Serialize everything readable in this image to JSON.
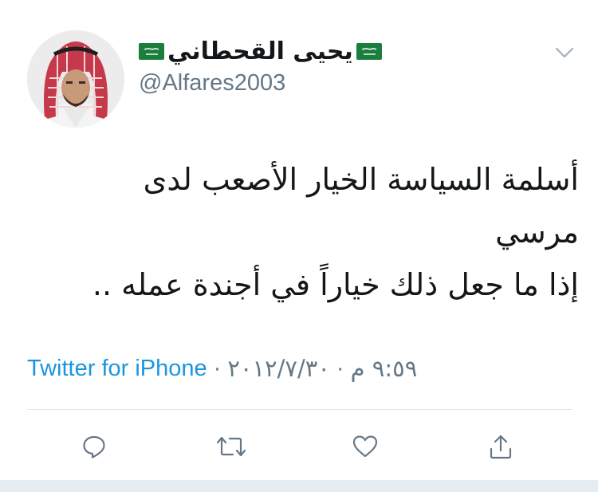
{
  "tweet": {
    "author": {
      "name": "يحيى القحطاني",
      "handle": "@Alfares2003",
      "avatar_icon": "profile-photo",
      "flag_icon": "saudi-flag"
    },
    "text_lines": [
      "أسلمة السياسة الخيار الأصعب لدى",
      "مرسي",
      "إذا ما جعل ذلك خياراً في أجندة عمله .."
    ],
    "time": "٩:٥٩ م",
    "date": "٢٠١٢/٧/٣٠",
    "separator": "·",
    "source": "Twitter for iPhone"
  },
  "actions": {
    "reply_icon": "reply-icon",
    "retweet_icon": "retweet-icon",
    "like_icon": "heart-icon",
    "share_icon": "share-icon",
    "menu_icon": "chevron-down-icon"
  },
  "colors": {
    "text": "#14171a",
    "secondary": "#657786",
    "link": "#1b95e0",
    "flag_green": "#1a7f3c",
    "divider": "#e1e8ed"
  }
}
